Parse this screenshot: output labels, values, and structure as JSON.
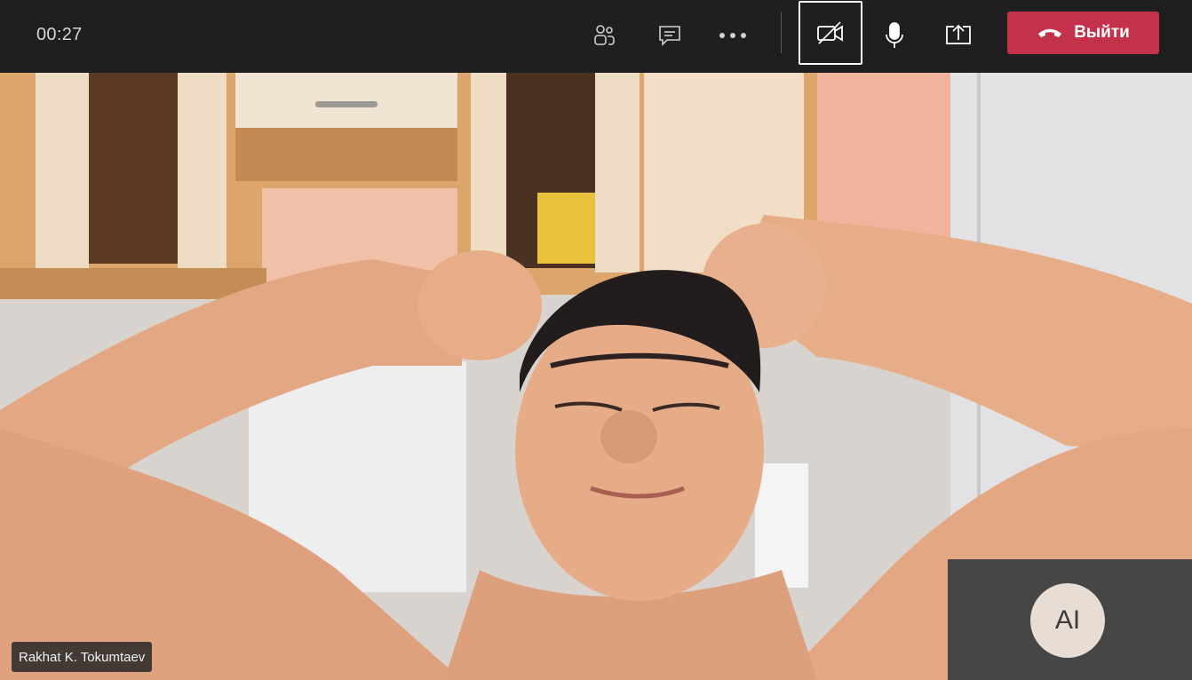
{
  "call": {
    "timer": "00:27"
  },
  "controls": {
    "participants_icon": "people-icon",
    "chat_icon": "chat-icon",
    "more_icon": "more-icon",
    "camera_icon": "camera-off-icon",
    "mic_icon": "microphone-icon",
    "share_icon": "share-screen-icon",
    "leave_label": "Выйти",
    "leave_color": "#c4314b"
  },
  "video": {
    "participant_name": "Rakhat K. Tokumtaev"
  },
  "self_view": {
    "initials": "AI"
  }
}
